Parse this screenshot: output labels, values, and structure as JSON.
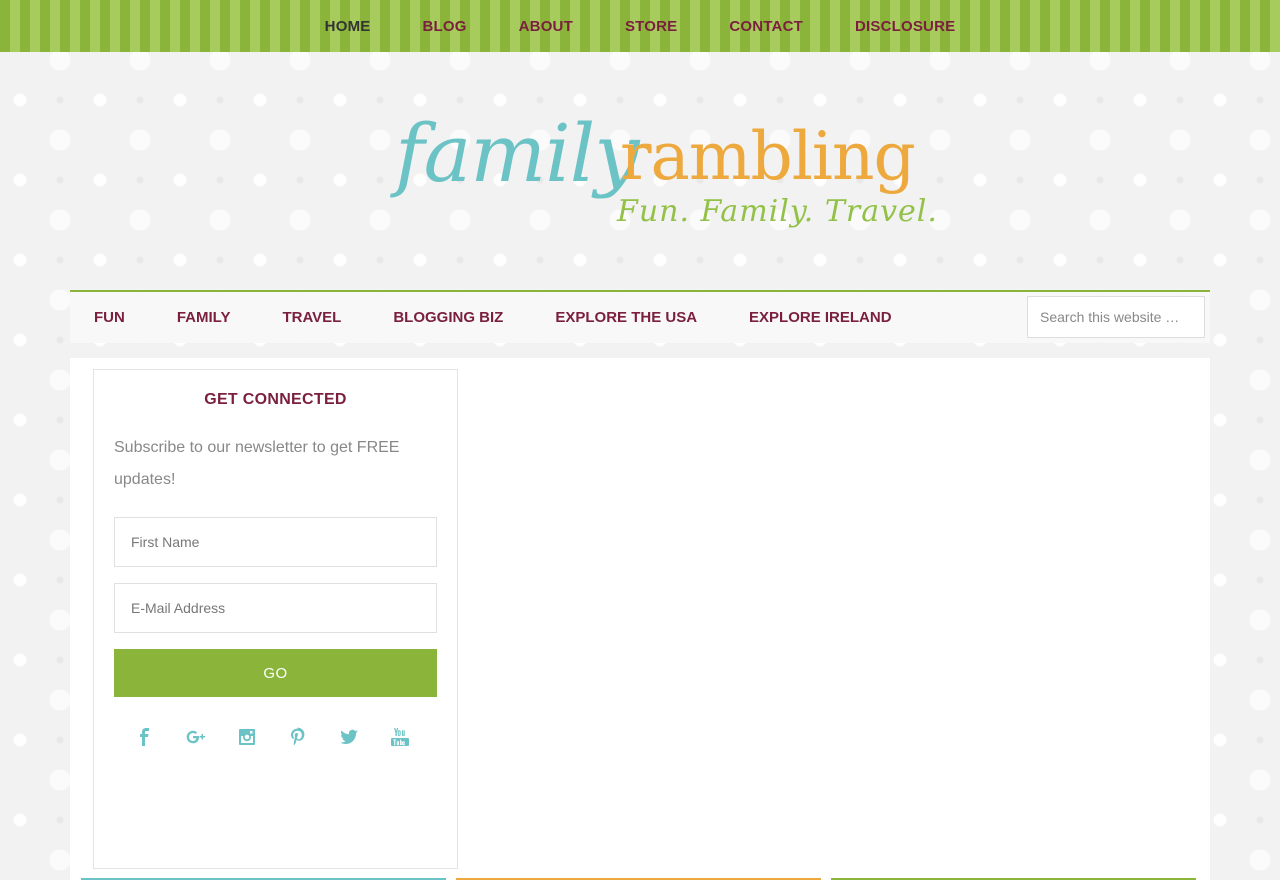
{
  "top_nav": [
    {
      "label": "HOME",
      "active": true
    },
    {
      "label": "BLOG",
      "active": false
    },
    {
      "label": "ABOUT",
      "active": false
    },
    {
      "label": "STORE",
      "active": false
    },
    {
      "label": "CONTACT",
      "active": false
    },
    {
      "label": "DISCLOSURE",
      "active": false
    }
  ],
  "logo": {
    "word1": "family",
    "word2": "rambling",
    "tagline": "Fun. Family. Travel."
  },
  "sub_nav": [
    "FUN",
    "FAMILY",
    "TRAVEL",
    "BLOGGING BIZ",
    "EXPLORE THE USA",
    "EXPLORE IRELAND"
  ],
  "search": {
    "placeholder": "Search this website …"
  },
  "newsletter": {
    "title": "GET CONNECTED",
    "text": "Subscribe to our newsletter to get FREE updates!",
    "first_name_placeholder": "First Name",
    "email_placeholder": "E-Mail Address",
    "button_label": "GO"
  },
  "social_icons": [
    "facebook-icon",
    "google-plus-icon",
    "instagram-icon",
    "pinterest-icon",
    "twitter-icon",
    "youtube-icon"
  ],
  "colors": {
    "accent_green": "#8bb53a",
    "link_maroon": "#7a1f3d",
    "teal": "#6cc3c6",
    "orange": "#eda93d"
  }
}
